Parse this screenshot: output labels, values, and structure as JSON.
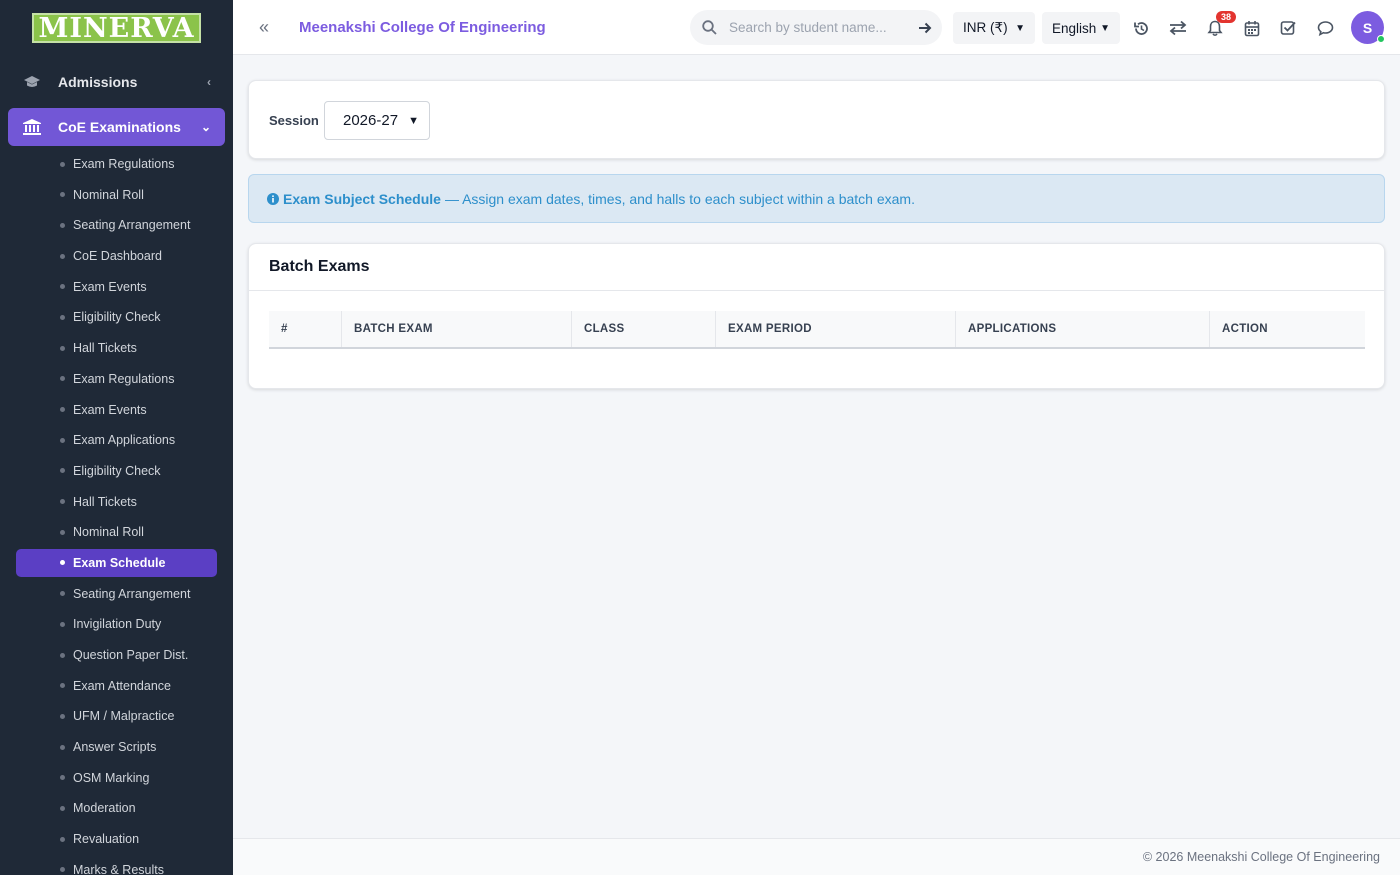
{
  "brand": {
    "logo_text": "MINERVA"
  },
  "sidebar": {
    "admissions_label": "Admissions",
    "coe_label": "CoE Examinations",
    "items": [
      {
        "label": "Exam Regulations"
      },
      {
        "label": "Nominal Roll"
      },
      {
        "label": "Seating Arrangement"
      },
      {
        "label": "CoE Dashboard"
      },
      {
        "label": "Exam Events"
      },
      {
        "label": "Eligibility Check"
      },
      {
        "label": "Hall Tickets"
      },
      {
        "label": "Exam Regulations"
      },
      {
        "label": "Exam Events"
      },
      {
        "label": "Exam Applications"
      },
      {
        "label": "Eligibility Check"
      },
      {
        "label": "Hall Tickets"
      },
      {
        "label": "Nominal Roll"
      },
      {
        "label": "Exam Schedule",
        "active": true
      },
      {
        "label": "Seating Arrangement"
      },
      {
        "label": "Invigilation Duty"
      },
      {
        "label": "Question Paper Dist."
      },
      {
        "label": "Exam Attendance"
      },
      {
        "label": "UFM / Malpractice"
      },
      {
        "label": "Answer Scripts"
      },
      {
        "label": "OSM Marking"
      },
      {
        "label": "Moderation"
      },
      {
        "label": "Revaluation"
      },
      {
        "label": "Marks & Results"
      }
    ]
  },
  "header": {
    "college_name": "Meenakshi College Of Engineering",
    "search_placeholder": "Search by student name...",
    "currency": "INR (₹)",
    "language": "English",
    "notification_count": "38",
    "avatar_initial": "S"
  },
  "session": {
    "label": "Session",
    "value": "2026-27"
  },
  "info": {
    "title": "Exam Subject Schedule",
    "text": "— Assign exam dates, times, and halls to each subject within a batch exam."
  },
  "batch": {
    "title": "Batch Exams",
    "columns": [
      "#",
      "BATCH EXAM",
      "CLASS",
      "EXAM PERIOD",
      "APPLICATIONS",
      "ACTION"
    ]
  },
  "footer": {
    "text": "© 2026 Meenakshi College Of Engineering"
  },
  "colors": {
    "accent": "#7c5ce0",
    "sidebar_bg": "#1f2937",
    "active_item": "#5b3fc4",
    "info_text": "#2d8fcb"
  }
}
